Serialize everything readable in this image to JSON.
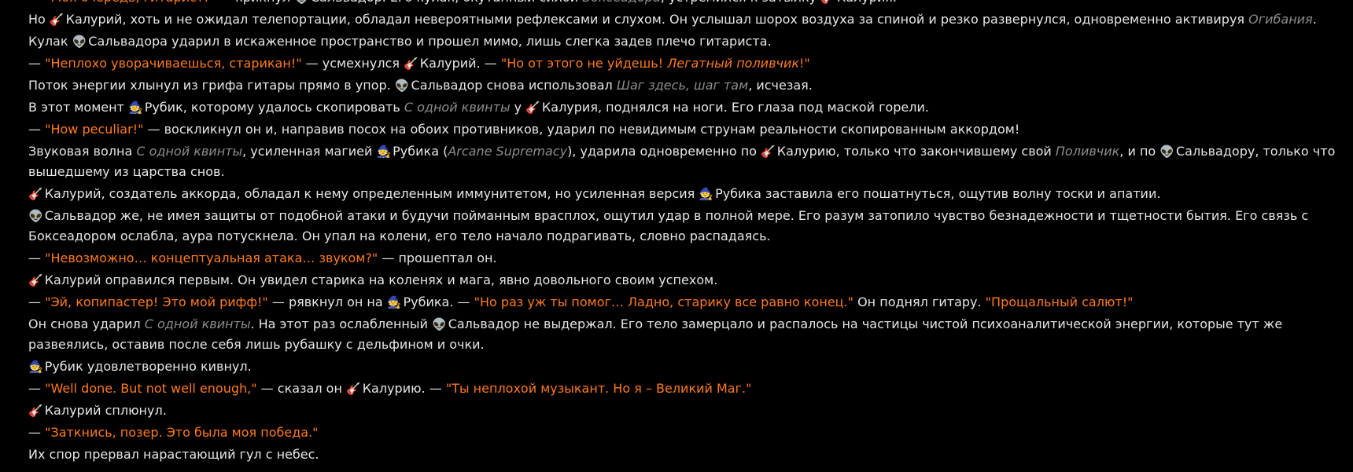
{
  "colors": {
    "background": "#000000",
    "narration": "#e6e6e6",
    "speech": "#ff7a1a",
    "skill": "#8d8d8d"
  },
  "icons": {
    "salvador": "alien-icon",
    "kaluriy": "guitar-icon",
    "rubik": "mage-icon"
  },
  "lines": [
    [
      {
        "t": "— "
      },
      {
        "t": "\"Моя очередь, гитарист!\"",
        "k": "q"
      },
      {
        "t": " — крикнул "
      },
      {
        "t": "👽",
        "k": "icon",
        "n": "alien-icon"
      },
      {
        "t": "Сальвадор. Его кулак, окутанный силой "
      },
      {
        "t": "Боксеадора",
        "k": "sk"
      },
      {
        "t": ", устремился к затылку "
      },
      {
        "t": "🎸",
        "k": "icon",
        "n": "guitar-icon"
      },
      {
        "t": "Калурия."
      }
    ],
    [
      {
        "t": "Но "
      },
      {
        "t": "🎸",
        "k": "icon",
        "n": "guitar-icon"
      },
      {
        "t": "Калурий, хоть и не ожидал телепортации, обладал невероятными рефлексами и слухом. Он услышал шорох воздуха за спиной и резко развернулся, одновременно активируя "
      },
      {
        "t": "Огибания",
        "k": "sk"
      },
      {
        "t": "."
      }
    ],
    [
      {
        "t": "Кулак "
      },
      {
        "t": "👽",
        "k": "icon",
        "n": "alien-icon"
      },
      {
        "t": "Сальвадора ударил в искаженное пространство и прошел мимо, лишь слегка задев плечо гитариста."
      }
    ],
    [
      {
        "t": "— "
      },
      {
        "t": "\"Неплохо уворачиваешься, старикан!\"",
        "k": "q"
      },
      {
        "t": " — усмехнулся "
      },
      {
        "t": "🎸",
        "k": "icon",
        "n": "guitar-icon"
      },
      {
        "t": "Калурий. — "
      },
      {
        "t": "\"Но от этого не уйдешь! ",
        "k": "q"
      },
      {
        "t": "Легатный поливчик",
        "k": "qi"
      },
      {
        "t": "!\"",
        "k": "q"
      }
    ],
    [
      {
        "t": "Поток энергии хлынул из грифа гитары прямо в упор. "
      },
      {
        "t": "👽",
        "k": "icon",
        "n": "alien-icon"
      },
      {
        "t": "Сальвадор снова использовал "
      },
      {
        "t": "Шаг здесь, шаг там",
        "k": "sk"
      },
      {
        "t": ", исчезая."
      }
    ],
    [
      {
        "t": "В этот момент "
      },
      {
        "t": "🧙",
        "k": "icon",
        "n": "mage-icon"
      },
      {
        "t": "Рубик, которому удалось скопировать "
      },
      {
        "t": "С одной квинты",
        "k": "sk"
      },
      {
        "t": " у "
      },
      {
        "t": "🎸",
        "k": "icon",
        "n": "guitar-icon"
      },
      {
        "t": "Калурия, поднялся на ноги. Его глаза под маской горели."
      }
    ],
    [
      {
        "t": "— "
      },
      {
        "t": "\"How peculiar!\"",
        "k": "q"
      },
      {
        "t": " — воскликнул он и, направив посох на обоих противников, ударил по невидимым струнам реальности скопированным аккордом!"
      }
    ],
    [
      {
        "t": "Звуковая волна "
      },
      {
        "t": "С одной квинты",
        "k": "sk"
      },
      {
        "t": ", усиленная магией "
      },
      {
        "t": "🧙",
        "k": "icon",
        "n": "mage-icon"
      },
      {
        "t": "Рубика ("
      },
      {
        "t": "Arcane Supremacy",
        "k": "sk"
      },
      {
        "t": "), ударила одновременно по "
      },
      {
        "t": "🎸",
        "k": "icon",
        "n": "guitar-icon"
      },
      {
        "t": "Калурию, только что закончившему свой "
      },
      {
        "t": "Поливчик",
        "k": "sk"
      },
      {
        "t": ", и по "
      },
      {
        "t": "👽",
        "k": "icon",
        "n": "alien-icon"
      },
      {
        "t": "Сальвадору, только что вышедшему из царства снов."
      }
    ],
    [
      {
        "t": "🎸",
        "k": "icon",
        "n": "guitar-icon"
      },
      {
        "t": "Калурий, создатель аккорда, обладал к нему определенным иммунитетом, но усиленная версия "
      },
      {
        "t": "🧙",
        "k": "icon",
        "n": "mage-icon"
      },
      {
        "t": "Рубика заставила его пошатнуться, ощутив волну тоски и апатии."
      }
    ],
    [
      {
        "t": "👽",
        "k": "icon",
        "n": "alien-icon"
      },
      {
        "t": "Сальвадор же, не имея защиты от подобной атаки и будучи пойманным врасплох, ощутил удар в полной мере. Его разум затопило чувство безнадежности и тщетности бытия. Его связь с Боксеадором ослабла, аура потускнела. Он упал на колени, его тело начало подрагивать, словно распадаясь."
      }
    ],
    [
      {
        "t": "— "
      },
      {
        "t": "\"Невозможно… концептуальная атака… звуком?\"",
        "k": "q"
      },
      {
        "t": " — прошептал он."
      }
    ],
    [
      {
        "t": "🎸",
        "k": "icon",
        "n": "guitar-icon"
      },
      {
        "t": "Калурий оправился первым. Он увидел старика на коленях и мага, явно довольного своим успехом."
      }
    ],
    [
      {
        "t": "— "
      },
      {
        "t": "\"Эй, копипастер! Это мой рифф!\"",
        "k": "q"
      },
      {
        "t": " — рявкнул он на "
      },
      {
        "t": "🧙",
        "k": "icon",
        "n": "mage-icon"
      },
      {
        "t": "Рубика. — "
      },
      {
        "t": "\"Но раз уж ты помог… Ладно, старику все равно конец.\"",
        "k": "q"
      },
      {
        "t": " Он поднял гитару. "
      },
      {
        "t": "\"Прощальный салют!\"",
        "k": "q"
      }
    ],
    [
      {
        "t": "Он снова ударил "
      },
      {
        "t": "С одной квинты",
        "k": "sk"
      },
      {
        "t": ". На этот раз ослабленный "
      },
      {
        "t": "👽",
        "k": "icon",
        "n": "alien-icon"
      },
      {
        "t": "Сальвадор не выдержал. Его тело замерцало и распалось на частицы чистой психоаналитической энергии, которые тут же развеялись, оставив после себя лишь рубашку с дельфином и очки."
      }
    ],
    [
      {
        "t": "🧙",
        "k": "icon",
        "n": "mage-icon"
      },
      {
        "t": "Рубик удовлетворенно кивнул."
      }
    ],
    [
      {
        "t": "— "
      },
      {
        "t": "\"Well done. But not well enough,\"",
        "k": "q"
      },
      {
        "t": " — сказал он "
      },
      {
        "t": "🎸",
        "k": "icon",
        "n": "guitar-icon"
      },
      {
        "t": "Калурию. — "
      },
      {
        "t": "\"Ты неплохой музыкант. Но я – Великий Маг.\"",
        "k": "q"
      }
    ],
    [
      {
        "t": "🎸",
        "k": "icon",
        "n": "guitar-icon"
      },
      {
        "t": "Калурий сплюнул."
      }
    ],
    [
      {
        "t": "— "
      },
      {
        "t": "\"Заткнись, позер. Это была моя победа.\"",
        "k": "q"
      }
    ],
    [
      {
        "t": "Их спор прервал нарастающий гул с небес."
      }
    ]
  ]
}
